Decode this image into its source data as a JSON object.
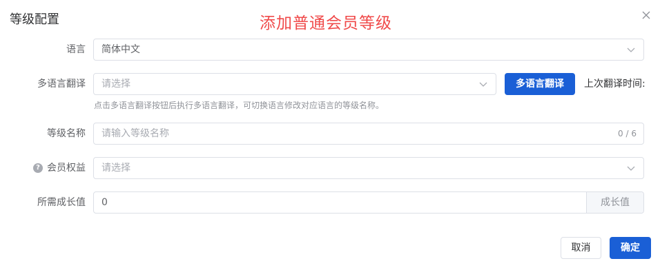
{
  "dialog": {
    "title": "等级配置",
    "annotation": "添加普通会员等级"
  },
  "form": {
    "language": {
      "label": "语言",
      "value": "简体中文"
    },
    "translation": {
      "label": "多语言翻译",
      "placeholder": "请选择",
      "button_label": "多语言翻译",
      "last_time_label": "上次翻译时间:",
      "help_text": "点击多语言翻译按钮后执行多语言翻译，可切换语言修改对应语言的等级名称。"
    },
    "level_name": {
      "label": "等级名称",
      "placeholder": "请输入等级名称",
      "count": "0 / 6"
    },
    "benefits": {
      "label": "会员权益",
      "placeholder": "请选择",
      "help_icon": "question-circle-icon"
    },
    "growth": {
      "label": "所需成长值",
      "value": "0",
      "suffix": "成长值"
    }
  },
  "footer": {
    "cancel_label": "取消",
    "confirm_label": "确定"
  },
  "colors": {
    "primary": "#1a5fd6",
    "annotation": "#f04a4a",
    "border": "#dcdfe6"
  }
}
